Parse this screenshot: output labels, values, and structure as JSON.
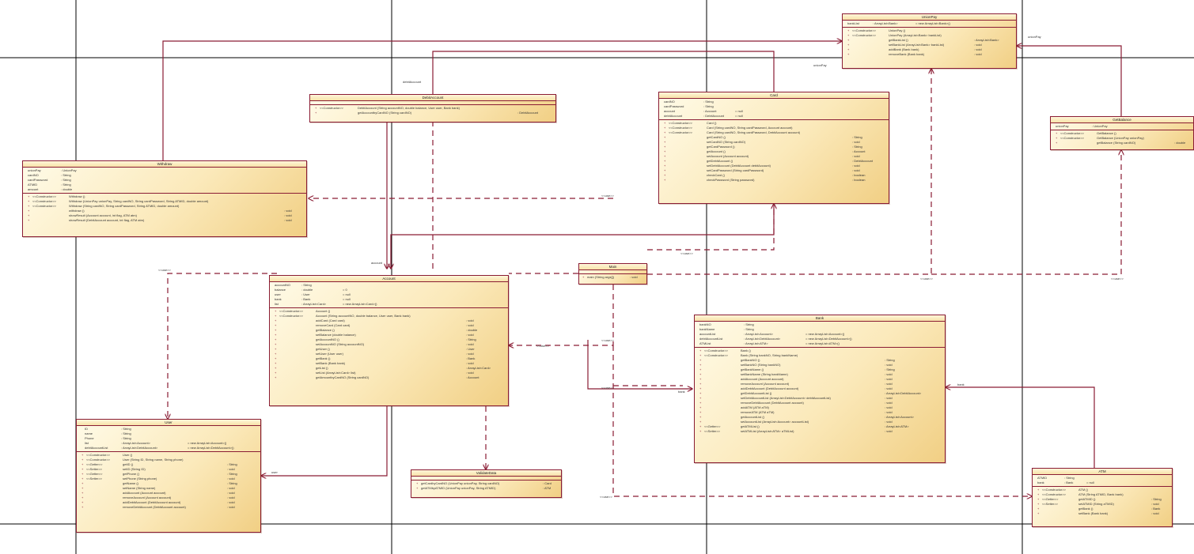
{
  "classes": [
    {
      "id": "unionpay",
      "title": "UnionPay",
      "attributes": [
        {
          "name": "bankList",
          "type": ": ArrayList<Bank>",
          "init": "= new ArrayList<Bank>()"
        }
      ],
      "methods": [
        {
          "vis": "+",
          "stereo": "<<Constructor>>",
          "name": "UnionPay ()",
          "ret": ""
        },
        {
          "vis": "+",
          "stereo": "<<Constructor>>",
          "name": "UnionPay (ArrayList<Bank> bankList)",
          "ret": ""
        },
        {
          "vis": "+",
          "stereo": "",
          "name": "getBankList ()",
          "ret": ": ArrayList<Bank>"
        },
        {
          "vis": "+",
          "stereo": "",
          "name": "setBankList (ArrayList<Bank> bankList)",
          "ret": ": void"
        },
        {
          "vis": "+",
          "stereo": "",
          "name": "addBank (Bank bank)",
          "ret": ": void"
        },
        {
          "vis": "+",
          "stereo": "",
          "name": "removeBank (Bank bank)",
          "ret": ": void"
        }
      ]
    },
    {
      "id": "debitaccount",
      "title": "DebitAccount",
      "attributes": [],
      "methods": [
        {
          "vis": "+",
          "stereo": "<<Constructor>>",
          "name": "DebitAccount (String accountNO, double balance, User user, Bank bank)",
          "ret": ""
        },
        {
          "vis": "+",
          "stereo": "",
          "name": "getAccountbyCardNO (String cardNO)",
          "ret": ": DebitAccount"
        }
      ]
    },
    {
      "id": "card",
      "title": "Card",
      "attributes": [
        {
          "name": "cardNO",
          "type": ": String",
          "init": ""
        },
        {
          "name": "cardPassword",
          "type": ": String",
          "init": ""
        },
        {
          "name": "account",
          "type": ": Account",
          "init": "= null"
        },
        {
          "name": "debitAccount",
          "type": ": DebitAccount",
          "init": "= null"
        }
      ],
      "methods": [
        {
          "vis": "+",
          "stereo": "<<Constructor>>",
          "name": "Card ()",
          "ret": ""
        },
        {
          "vis": "+",
          "stereo": "<<Constructor>>",
          "name": "Card (String cardNO, String cardPassword, Account account)",
          "ret": ""
        },
        {
          "vis": "+",
          "stereo": "<<Constructor>>",
          "name": "Card (String cardNO, String cardPassword, DebitAccount account)",
          "ret": ""
        },
        {
          "vis": "+",
          "stereo": "",
          "name": "getCardNO ()",
          "ret": ": String"
        },
        {
          "vis": "+",
          "stereo": "",
          "name": "setCardNO (String cardNO)",
          "ret": ": void"
        },
        {
          "vis": "+",
          "stereo": "",
          "name": "getCardPassword ()",
          "ret": ": String"
        },
        {
          "vis": "+",
          "stereo": "",
          "name": "getAccount ()",
          "ret": ": Account"
        },
        {
          "vis": "+",
          "stereo": "",
          "name": "setAccount (Account account)",
          "ret": ": void"
        },
        {
          "vis": "+",
          "stereo": "",
          "name": "getDebitAccount ()",
          "ret": ": DebitAccount"
        },
        {
          "vis": "+",
          "stereo": "",
          "name": "setDebitAccount (DebitAccount debitAccount)",
          "ret": ": void"
        },
        {
          "vis": "+",
          "stereo": "",
          "name": "setCardPassword (String cardPassword)",
          "ret": ": void"
        },
        {
          "vis": "+",
          "stereo": "",
          "name": "checkCard ()",
          "ret": ": boolean"
        },
        {
          "vis": "+",
          "stereo": "",
          "name": "checkPassword (String password)",
          "ret": ": boolean"
        }
      ]
    },
    {
      "id": "getbalance",
      "title": "GetBalance",
      "attributes": [
        {
          "name": "unionPay",
          "type": ": UnionPay",
          "init": ""
        }
      ],
      "methods": [
        {
          "vis": "+",
          "stereo": "<<Constructor>>",
          "name": "GetBalance ()",
          "ret": ""
        },
        {
          "vis": "+",
          "stereo": "<<Constructor>>",
          "name": "GetBalance (UnionPay unionPay)",
          "ret": ""
        },
        {
          "vis": "+",
          "stereo": "",
          "name": "getBalance (String cardNO)",
          "ret": ": double"
        }
      ]
    },
    {
      "id": "withdraw",
      "title": "Withdraw",
      "attributes": [
        {
          "name": "unionPay",
          "type": ": UnionPay",
          "init": ""
        },
        {
          "name": "cardNO",
          "type": ": String",
          "init": ""
        },
        {
          "name": "cardPassword",
          "type": ": String",
          "init": ""
        },
        {
          "name": "ATMID",
          "type": ": String",
          "init": ""
        },
        {
          "name": "amount",
          "type": ": double",
          "init": ""
        }
      ],
      "methods": [
        {
          "vis": "+",
          "stereo": "<<Constructor>>",
          "name": "Withdraw ()",
          "ret": ""
        },
        {
          "vis": "+",
          "stereo": "<<Constructor>>",
          "name": "Withdraw (UnionPay unionPay, String cardNO, String cardPassword, String ATMID, double amount)",
          "ret": ""
        },
        {
          "vis": "+",
          "stereo": "<<Constructor>>",
          "name": "Withdraw (String cardNO, String cardPassword, String ATMID, double amount)",
          "ret": ""
        },
        {
          "vis": "+",
          "stereo": "",
          "name": "withdraw ()",
          "ret": ": void"
        },
        {
          "vis": "+",
          "stereo": "",
          "name": "showResult (Account account, int flag, ATM atm)",
          "ret": ": void"
        },
        {
          "vis": "+",
          "stereo": "",
          "name": "showResult (DebitAccount account, int flag, ATM atm)",
          "ret": ": void"
        }
      ]
    },
    {
      "id": "main",
      "title": "Main",
      "attributes": [],
      "methods": [
        {
          "vis": "+",
          "stereo": "",
          "name": "main (String args[])",
          "ret": ": void"
        }
      ]
    },
    {
      "id": "account",
      "title": "Account",
      "attributes": [
        {
          "name": "accountNO",
          "type": ": String",
          "init": ""
        },
        {
          "name": "balance",
          "type": ": double",
          "init": "= 0"
        },
        {
          "name": "user",
          "type": ": User",
          "init": "= null"
        },
        {
          "name": "bank",
          "type": ": Bank",
          "init": "= null"
        },
        {
          "name": "list",
          "type": ": ArrayList<Card>",
          "init": "= new ArrayList<Card>()"
        }
      ],
      "methods": [
        {
          "vis": "+",
          "stereo": "<<Constructor>>",
          "name": "Account ()",
          "ret": ""
        },
        {
          "vis": "+",
          "stereo": "<<Constructor>>",
          "name": "Account (String accountNO, double balance, User user, Bank bank)",
          "ret": ""
        },
        {
          "vis": "+",
          "stereo": "",
          "name": "addCard (Card card)",
          "ret": ": void"
        },
        {
          "vis": "+",
          "stereo": "",
          "name": "removeCard (Card card)",
          "ret": ": void"
        },
        {
          "vis": "+",
          "stereo": "",
          "name": "getBalance ()",
          "ret": ": double"
        },
        {
          "vis": "+",
          "stereo": "",
          "name": "setBalance (double balance)",
          "ret": ": void"
        },
        {
          "vis": "+",
          "stereo": "",
          "name": "getAccountNO ()",
          "ret": ": String"
        },
        {
          "vis": "+",
          "stereo": "",
          "name": "setAccountNO (String accountNO)",
          "ret": ": void"
        },
        {
          "vis": "+",
          "stereo": "",
          "name": "getUser ()",
          "ret": ": User"
        },
        {
          "vis": "+",
          "stereo": "",
          "name": "setUser (User user)",
          "ret": ": void"
        },
        {
          "vis": "+",
          "stereo": "",
          "name": "getBank ()",
          "ret": ": Bank"
        },
        {
          "vis": "+",
          "stereo": "",
          "name": "setBank (Bank bank)",
          "ret": ": void"
        },
        {
          "vis": "+",
          "stereo": "",
          "name": "getList ()",
          "ret": ": ArrayList<Card>"
        },
        {
          "vis": "+",
          "stereo": "",
          "name": "setList (ArrayList<Card> list)",
          "ret": ": void"
        },
        {
          "vis": "+",
          "stereo": "",
          "name": "getAmountbyCardNO (String cardNO)",
          "ret": ": Account"
        }
      ]
    },
    {
      "id": "bank",
      "title": "Bank",
      "attributes": [
        {
          "name": "bankNO",
          "type": ": String",
          "init": ""
        },
        {
          "name": "bankName",
          "type": ": String",
          "init": ""
        },
        {
          "name": "accountList",
          "type": ": ArrayList<Account>",
          "init": "= new ArrayList<Account>()"
        },
        {
          "name": "debitAccountList",
          "type": ": ArrayList<DebitAccount>",
          "init": "= new ArrayList<DebitAccount>()"
        },
        {
          "name": "ATMList",
          "type": ": ArrayList<ATM>",
          "init": "= new ArrayList<ATM>()"
        }
      ],
      "methods": [
        {
          "vis": "+",
          "stereo": "<<Constructor>>",
          "name": "Bank ()",
          "ret": ""
        },
        {
          "vis": "+",
          "stereo": "<<Constructor>>",
          "name": "Bank (String bankNO, String bankName)",
          "ret": ""
        },
        {
          "vis": "+",
          "stereo": "",
          "name": "getBankNO ()",
          "ret": ": String"
        },
        {
          "vis": "+",
          "stereo": "",
          "name": "setBankNO (String bankNO)",
          "ret": ": void"
        },
        {
          "vis": "+",
          "stereo": "",
          "name": "getBankName ()",
          "ret": ": String"
        },
        {
          "vis": "+",
          "stereo": "",
          "name": "setBankName (String bankName)",
          "ret": ": void"
        },
        {
          "vis": "+",
          "stereo": "",
          "name": "addAccount (Account account)",
          "ret": ": void"
        },
        {
          "vis": "+",
          "stereo": "",
          "name": "removeAccount (Account account)",
          "ret": ": void"
        },
        {
          "vis": "+",
          "stereo": "",
          "name": "addDebitAccount (DebitAccount account)",
          "ret": ": void"
        },
        {
          "vis": "+",
          "stereo": "",
          "name": "getDebitAccountList ()",
          "ret": ": ArrayList<DebitAccount>"
        },
        {
          "vis": "+",
          "stereo": "",
          "name": "setDebitAccountList (ArrayList<DebitAccount> debitAccountList)",
          "ret": ": void"
        },
        {
          "vis": "+",
          "stereo": "",
          "name": "removeDebitAccount (DebitAccount account)",
          "ret": ": void"
        },
        {
          "vis": "+",
          "stereo": "",
          "name": "addATM (ATM aTM)",
          "ret": ": void"
        },
        {
          "vis": "+",
          "stereo": "",
          "name": "removeATM (ATM aTM)",
          "ret": ": void"
        },
        {
          "vis": "+",
          "stereo": "",
          "name": "getAccountList ()",
          "ret": ": ArrayList<Account>"
        },
        {
          "vis": "+",
          "stereo": "",
          "name": "setAccountList (ArrayList<Account> accountList)",
          "ret": ": void"
        },
        {
          "vis": "+",
          "stereo": "<<Getter>>",
          "name": "getATMList ()",
          "ret": ": ArrayList<ATM>"
        },
        {
          "vis": "+",
          "stereo": "<<Setter>>",
          "name": "setATMList (ArrayList<ATM> aTMList)",
          "ret": ": void"
        }
      ]
    },
    {
      "id": "user",
      "title": "User",
      "attributes": [
        {
          "name": "ID",
          "type": ": String",
          "init": ""
        },
        {
          "name": "name",
          "type": ": String",
          "init": ""
        },
        {
          "name": "Phone",
          "type": ": String",
          "init": ""
        },
        {
          "name": "list",
          "type": ": ArrayList<Account>",
          "init": "= new ArrayList<Account>()"
        },
        {
          "name": "debitAccountList",
          "type": ": ArrayList<DebitAccount>",
          "init": "= new ArrayList<DebitAccount>()"
        }
      ],
      "methods": [
        {
          "vis": "+",
          "stereo": "<<Constructor>>",
          "name": "User ()",
          "ret": ""
        },
        {
          "vis": "+",
          "stereo": "<<Constructor>>",
          "name": "User (String ID, String name, String phone)",
          "ret": ""
        },
        {
          "vis": "+",
          "stereo": "<<Getter>>",
          "name": "getID ()",
          "ret": ": String"
        },
        {
          "vis": "+",
          "stereo": "<<Setter>>",
          "name": "setID (String ID)",
          "ret": ": void"
        },
        {
          "vis": "+",
          "stereo": "<<Getter>>",
          "name": "getPhone ()",
          "ret": ": String"
        },
        {
          "vis": "+",
          "stereo": "<<Setter>>",
          "name": "setPhone (String phone)",
          "ret": ": void"
        },
        {
          "vis": "+",
          "stereo": "",
          "name": "getName ()",
          "ret": ": String"
        },
        {
          "vis": "+",
          "stereo": "",
          "name": "setName (String name)",
          "ret": ": void"
        },
        {
          "vis": "+",
          "stereo": "",
          "name": "addAccount (Account account)",
          "ret": ": void"
        },
        {
          "vis": "+",
          "stereo": "",
          "name": "removeAccount (Account account)",
          "ret": ": void"
        },
        {
          "vis": "+",
          "stereo": "",
          "name": "addDebitAccount (DebitAccount account)",
          "ret": ": void"
        },
        {
          "vis": "+",
          "stereo": "",
          "name": "removeDebitAccount (DebitAccount account)",
          "ret": ": void"
        }
      ]
    },
    {
      "id": "validatedata",
      "title": "ValidateData",
      "attributes": [],
      "methods": [
        {
          "vis": "+",
          "stereo": "",
          "name": "getCardbyCardNO (UnionPay unionPay, String cardNO)",
          "ret": ": Card"
        },
        {
          "vis": "+",
          "stereo": "",
          "name": "getATMbyATMID (UnionPay unionPay, String ATMID)",
          "ret": ": ATM"
        }
      ]
    },
    {
      "id": "atm",
      "title": "ATM",
      "attributes": [
        {
          "name": "ATMID",
          "type": ": String",
          "init": ""
        },
        {
          "name": "bank",
          "type": ": Bank",
          "init": "= null"
        }
      ],
      "methods": [
        {
          "vis": "+",
          "stereo": "<<Constructor>>",
          "name": "ATM ()",
          "ret": ""
        },
        {
          "vis": "+",
          "stereo": "<<Constructor>>",
          "name": "ATM (String ATMID, Bank bank)",
          "ret": ""
        },
        {
          "vis": "+",
          "stereo": "<<Getter>>",
          "name": "getATMID ()",
          "ret": ": String"
        },
        {
          "vis": "+",
          "stereo": "<<Setter>>",
          "name": "setATMID (String aTMID)",
          "ret": ": void"
        },
        {
          "vis": "+",
          "stereo": "",
          "name": "getBank ()",
          "ret": ": Bank"
        },
        {
          "vis": "+",
          "stereo": "",
          "name": "setBank (Bank bank)",
          "ret": ": void"
        }
      ]
    }
  ],
  "relation_labels": {
    "unionpay_left": "unionPay",
    "unionpay_right": "unionPay",
    "debitaccount": "debitAccount",
    "account": "account",
    "bank": "bank",
    "bank2": "bank",
    "user": "user",
    "use_withdraw_user": "<<use>>",
    "use_main_card": "<<use>>",
    "use_main_unionpay": "<<use>>",
    "use_main_getbalance": "<<use>>",
    "use_main_withdraw": "<<use>>",
    "use_main_account": "<<use>>",
    "use_main_account2": "<<use>>",
    "use_main_bank": "<<use>>",
    "use_main_atm": "<<use>>",
    "use_account": "<<use>>"
  },
  "colors": {
    "border": "#8a1c34",
    "link": "#8a1c34",
    "grid": "#000000"
  }
}
